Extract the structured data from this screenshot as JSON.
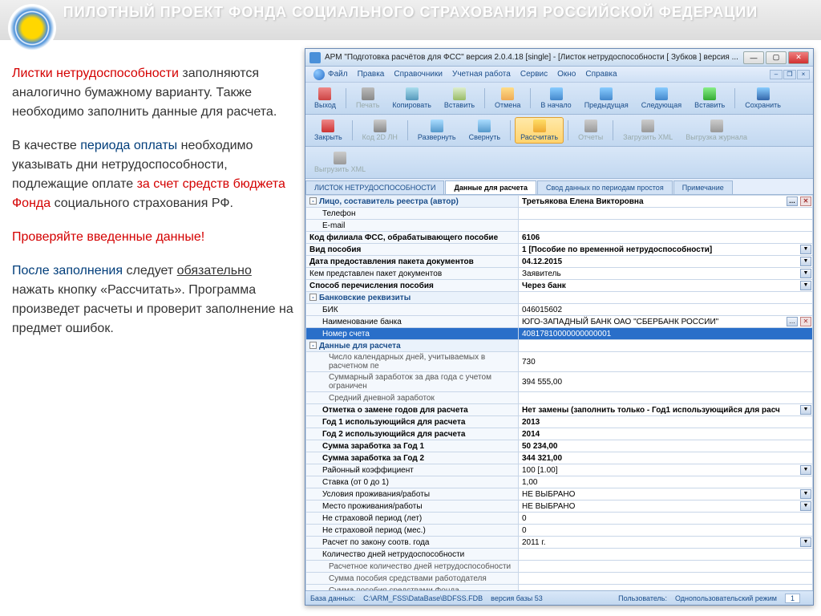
{
  "slide": {
    "title": "ПИЛОТНЫЙ ПРОЕКТ ФОНДА  СОЦИАЛЬНОГО  СТРАХОВАНИЯ  РОССИЙСКОЙ ФЕДЕРАЦИИ"
  },
  "left_text": {
    "p1a": "Листки нетрудоспособности",
    "p1b": " заполняются аналогично бумажному варианту. Также необходимо заполнить данные для расчета.",
    "p2a": "В качестве ",
    "p2b": "периода оплаты",
    "p2c": " необходимо указывать  дни нетрудоспособности, подлежащие оплате ",
    "p2d": "за счет средств бюджета Фонда",
    "p2e": " социального страхования РФ.",
    "p3": "Проверяйте введенные данные!",
    "p4a": "После заполнения",
    "p4b": " следует ",
    "p4c": "обязательно",
    "p4d": " нажать кнопку «Рассчитать».  Программа произведет расчеты и проверит заполнение на предмет ошибок."
  },
  "window": {
    "title": "АРМ \"Подготовка расчётов для ФСС\"   версия 2.0.4.18 [single] - [Листок нетрудоспособности [ Зубков ]  версия ..."
  },
  "menu": [
    "Файл",
    "Правка",
    "Справочники",
    "Учетная работа",
    "Сервис",
    "Окно",
    "Справка"
  ],
  "toolbar1": [
    {
      "label": "Выход",
      "ic": "ic-exit"
    },
    {
      "sep": true
    },
    {
      "label": "Печать",
      "ic": "ic-print",
      "disabled": true
    },
    {
      "label": "Копировать",
      "ic": "ic-copy"
    },
    {
      "label": "Вставить",
      "ic": "ic-paste"
    },
    {
      "sep": true
    },
    {
      "label": "Отмена",
      "ic": "ic-undo"
    },
    {
      "sep": true
    },
    {
      "label": "В начало",
      "ic": "ic-first"
    },
    {
      "label": "Предыдущая",
      "ic": "ic-prev"
    },
    {
      "label": "Следующая",
      "ic": "ic-next"
    },
    {
      "label": "Вставить",
      "ic": "ic-ins"
    },
    {
      "sep": true
    },
    {
      "label": "Сохранить",
      "ic": "ic-save"
    }
  ],
  "toolbar2": [
    {
      "label": "Закрыть",
      "ic": "ic-close"
    },
    {
      "sep": true
    },
    {
      "label": "Код 2D ЛН",
      "ic": "ic-code",
      "disabled": true
    },
    {
      "sep": true
    },
    {
      "label": "Развернуть",
      "ic": "ic-expand"
    },
    {
      "label": "Свернуть",
      "ic": "ic-collapse"
    },
    {
      "sep": true
    },
    {
      "label": "Рассчитать",
      "ic": "ic-calc",
      "active": true
    },
    {
      "sep": true
    },
    {
      "label": "Отчеты",
      "ic": "ic-report",
      "disabled": true
    },
    {
      "sep": true
    },
    {
      "label": "Загрузить XML",
      "ic": "ic-xml",
      "disabled": true
    },
    {
      "label": "Выгрузка журнала",
      "ic": "ic-export",
      "disabled": true
    }
  ],
  "toolbar3": [
    {
      "label": "Выгрузить XML",
      "ic": "ic-xml",
      "disabled": true
    }
  ],
  "tabs": [
    "ЛИСТОК НЕТРУДОСПОСОБНОСТИ",
    "Данные для расчета",
    "Свод данных по периодам простоя",
    "Примечание"
  ],
  "active_tab": 1,
  "rows": [
    {
      "type": "sect",
      "label": "Лицо, составитель реестра (автор)",
      "value": "Третьякова Елена Викторовна",
      "ellip": true,
      "x": true,
      "bold": true
    },
    {
      "type": "item",
      "label": "Телефон",
      "value": "",
      "indent": 1
    },
    {
      "type": "item",
      "label": "E-mail",
      "value": "",
      "indent": 1
    },
    {
      "type": "item",
      "label": "Код филиала ФСС, обрабатывающего пособие",
      "value": "6106",
      "bold": true
    },
    {
      "type": "item",
      "label": "Вид пособия",
      "value": "1 [Пособие по временной нетрудоспособности]",
      "bold": true,
      "dd": true
    },
    {
      "type": "item",
      "label": "Дата предоставления пакета документов",
      "value": "04.12.2015",
      "bold": true,
      "dd": true
    },
    {
      "type": "item",
      "label": "Кем представлен пакет документов",
      "value": "Заявитель",
      "dd": true
    },
    {
      "type": "item",
      "label": "Способ перечисления пособия",
      "value": "Через банк",
      "bold": true,
      "dd": true
    },
    {
      "type": "sect",
      "label": "Банковские реквизиты",
      "value": ""
    },
    {
      "type": "item",
      "label": "БИК",
      "value": "046015602",
      "indent": 1
    },
    {
      "type": "item",
      "label": "Наименование банка",
      "value": "ЮГО-ЗАПАДНЫЙ БАНК ОАО \"СБЕРБАНК РОССИИ\"",
      "indent": 1,
      "ellip": true,
      "x": true
    },
    {
      "type": "sel",
      "label": "Номер счета",
      "value": "40817810000000000001",
      "indent": 1
    },
    {
      "type": "sect",
      "label": "Данные для расчета",
      "value": ""
    },
    {
      "type": "item",
      "label": "Число календарных дней, учитываемых в расчетном пе",
      "value": "730",
      "indent": 2
    },
    {
      "type": "item",
      "label": "Суммарный заработок за два года с учетом ограничен",
      "value": "394 555,00",
      "indent": 2
    },
    {
      "type": "item",
      "label": "Средний дневной заработок",
      "value": "",
      "indent": 2
    },
    {
      "type": "item",
      "label": "Отметка о замене годов для расчета",
      "value": "Нет замены (заполнить только - Год1 использующийся для расч",
      "indent": 1,
      "bold": true,
      "dd": true
    },
    {
      "type": "item",
      "label": "Год 1 использующийся для расчета",
      "value": "2013",
      "indent": 1,
      "bold": true
    },
    {
      "type": "item",
      "label": "Год 2 использующийся для расчета",
      "value": "2014",
      "indent": 1,
      "bold": true
    },
    {
      "type": "item",
      "label": "Сумма заработка за Год 1",
      "value": "50 234,00",
      "indent": 1,
      "bold": true
    },
    {
      "type": "item",
      "label": "Сумма заработка за Год 2",
      "value": "344 321,00",
      "indent": 1,
      "bold": true
    },
    {
      "type": "item",
      "label": "Районный коэффициент",
      "value": "100 [1.00]",
      "indent": 1,
      "dd": true
    },
    {
      "type": "item",
      "label": "Ставка (от 0 до 1)",
      "value": "1,00",
      "indent": 1
    },
    {
      "type": "item",
      "label": "Условия проживания/работы",
      "value": "НЕ ВЫБРАНО",
      "indent": 1,
      "dd": true
    },
    {
      "type": "item",
      "label": "Место проживания/работы",
      "value": "НЕ ВЫБРАНО",
      "indent": 1,
      "dd": true
    },
    {
      "type": "item",
      "label": "Не страховой период (лет)",
      "value": "0",
      "indent": 1
    },
    {
      "type": "item",
      "label": "Не страховой период (мес.)",
      "value": "0",
      "indent": 1
    },
    {
      "type": "item",
      "label": "Расчет по закону соотв. года",
      "value": "2011 г.",
      "indent": 1,
      "dd": true
    },
    {
      "type": "item",
      "label": "Количество дней нетрудоспособности",
      "value": "",
      "indent": 1
    },
    {
      "type": "link",
      "label": "Расчетное количество дней нетрудоспособности",
      "value": "",
      "indent": 2
    },
    {
      "type": "link",
      "label": "Сумма пособия средствами работодателя",
      "value": "",
      "indent": 2
    },
    {
      "type": "link",
      "label": "Сумма пособия средствами Фонда",
      "value": "",
      "indent": 2
    }
  ],
  "status": {
    "db_label": "База данных:",
    "db_path": "C:\\ARM_FSS\\DataBase\\BDFSS.FDB",
    "db_ver": "  версия базы 53",
    "user_label": "Пользователь:",
    "user": "Однопользовательский режим",
    "page": "1"
  }
}
